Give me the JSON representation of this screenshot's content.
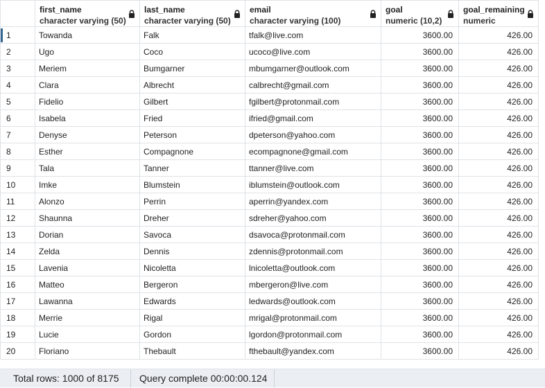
{
  "columns": [
    {
      "name": "first_name",
      "type": "character varying (50)"
    },
    {
      "name": "last_name",
      "type": "character varying (50)"
    },
    {
      "name": "email",
      "type": "character varying (100)"
    },
    {
      "name": "goal",
      "type": "numeric (10,2)"
    },
    {
      "name": "goal_remaining",
      "type": "numeric"
    }
  ],
  "rows": [
    {
      "n": "1",
      "first_name": "Towanda",
      "last_name": "Falk",
      "email": "tfalk@live.com",
      "goal": "3600.00",
      "goal_remaining": "426.00"
    },
    {
      "n": "2",
      "first_name": "Ugo",
      "last_name": "Coco",
      "email": "ucoco@live.com",
      "goal": "3600.00",
      "goal_remaining": "426.00"
    },
    {
      "n": "3",
      "first_name": "Meriem",
      "last_name": "Bumgarner",
      "email": "mbumgarner@outlook.com",
      "goal": "3600.00",
      "goal_remaining": "426.00"
    },
    {
      "n": "4",
      "first_name": "Clara",
      "last_name": "Albrecht",
      "email": "calbrecht@gmail.com",
      "goal": "3600.00",
      "goal_remaining": "426.00"
    },
    {
      "n": "5",
      "first_name": "Fidelio",
      "last_name": "Gilbert",
      "email": "fgilbert@protonmail.com",
      "goal": "3600.00",
      "goal_remaining": "426.00"
    },
    {
      "n": "6",
      "first_name": "Isabela",
      "last_name": "Fried",
      "email": "ifried@gmail.com",
      "goal": "3600.00",
      "goal_remaining": "426.00"
    },
    {
      "n": "7",
      "first_name": "Denyse",
      "last_name": "Peterson",
      "email": "dpeterson@yahoo.com",
      "goal": "3600.00",
      "goal_remaining": "426.00"
    },
    {
      "n": "8",
      "first_name": "Esther",
      "last_name": "Compagnone",
      "email": "ecompagnone@gmail.com",
      "goal": "3600.00",
      "goal_remaining": "426.00"
    },
    {
      "n": "9",
      "first_name": "Tala",
      "last_name": "Tanner",
      "email": "ttanner@live.com",
      "goal": "3600.00",
      "goal_remaining": "426.00"
    },
    {
      "n": "10",
      "first_name": "Imke",
      "last_name": "Blumstein",
      "email": "iblumstein@outlook.com",
      "goal": "3600.00",
      "goal_remaining": "426.00"
    },
    {
      "n": "11",
      "first_name": "Alonzo",
      "last_name": "Perrin",
      "email": "aperrin@yandex.com",
      "goal": "3600.00",
      "goal_remaining": "426.00"
    },
    {
      "n": "12",
      "first_name": "Shaunna",
      "last_name": "Dreher",
      "email": "sdreher@yahoo.com",
      "goal": "3600.00",
      "goal_remaining": "426.00"
    },
    {
      "n": "13",
      "first_name": "Dorian",
      "last_name": "Savoca",
      "email": "dsavoca@protonmail.com",
      "goal": "3600.00",
      "goal_remaining": "426.00"
    },
    {
      "n": "14",
      "first_name": "Zelda",
      "last_name": "Dennis",
      "email": "zdennis@protonmail.com",
      "goal": "3600.00",
      "goal_remaining": "426.00"
    },
    {
      "n": "15",
      "first_name": "Lavenia",
      "last_name": "Nicoletta",
      "email": "lnicoletta@outlook.com",
      "goal": "3600.00",
      "goal_remaining": "426.00"
    },
    {
      "n": "16",
      "first_name": "Matteo",
      "last_name": "Bergeron",
      "email": "mbergeron@live.com",
      "goal": "3600.00",
      "goal_remaining": "426.00"
    },
    {
      "n": "17",
      "first_name": "Lawanna",
      "last_name": "Edwards",
      "email": "ledwards@outlook.com",
      "goal": "3600.00",
      "goal_remaining": "426.00"
    },
    {
      "n": "18",
      "first_name": "Merrie",
      "last_name": "Rigal",
      "email": "mrigal@protonmail.com",
      "goal": "3600.00",
      "goal_remaining": "426.00"
    },
    {
      "n": "19",
      "first_name": "Lucie",
      "last_name": "Gordon",
      "email": "lgordon@protonmail.com",
      "goal": "3600.00",
      "goal_remaining": "426.00"
    },
    {
      "n": "20",
      "first_name": "Floriano",
      "last_name": "Thebault",
      "email": "fthebault@yandex.com",
      "goal": "3600.00",
      "goal_remaining": "426.00"
    }
  ],
  "status": {
    "total_rows": "Total rows: 1000 of 8175",
    "query": "Query complete 00:00:00.124"
  },
  "colors": {
    "selection_marker": "#326690",
    "status_bg": "#ebeef3",
    "grid_border": "#dee2e6"
  },
  "icons": {
    "column_lock": "lock-icon"
  }
}
